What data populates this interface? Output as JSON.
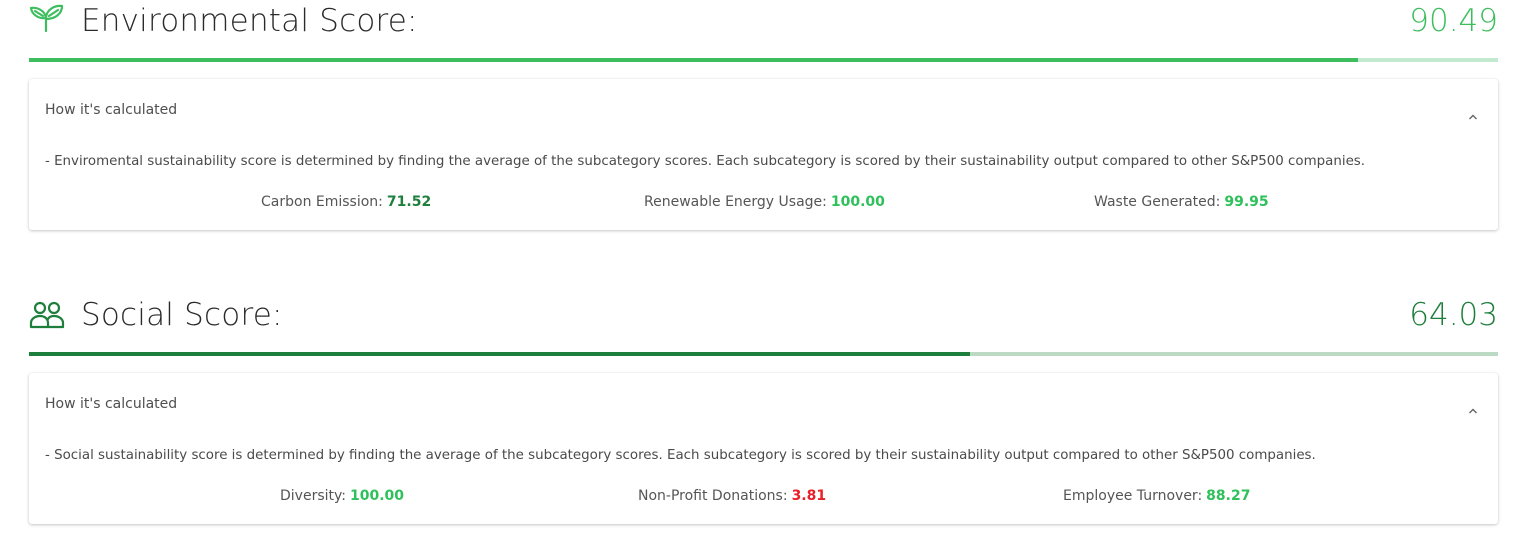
{
  "colors": {
    "good": "#2ec05a",
    "bad": "#e8202a",
    "environmental_accent": "#3dbd5e",
    "environmental_track": "#c2ead0",
    "social_accent": "#1e7f3c",
    "social_track": "#bcd9c4"
  },
  "environmental": {
    "icon": "sprout-icon",
    "title": "Environmental Score:",
    "score": "90.49",
    "progress_percent": 90.49,
    "summary": "How it's calculated",
    "description": "- Enviromental sustainability score is determined by finding the average of the subcategory scores. Each subcategory is scored by their sustainability output compared to other S&P500 companies.",
    "metrics": [
      {
        "label": "Carbon Emission:",
        "value": "71.52",
        "status": "dark"
      },
      {
        "label": "Renewable Energy Usage:",
        "value": "100.00",
        "status": "good"
      },
      {
        "label": "Waste Generated:",
        "value": "99.95",
        "status": "good"
      }
    ]
  },
  "social": {
    "icon": "people-icon",
    "title": "Social Score:",
    "score": "64.03",
    "progress_percent": 64.03,
    "summary": "How it's calculated",
    "description": "- Social sustainability score is determined by finding the average of the subcategory scores. Each subcategory is scored by their sustainability output compared to other S&P500 companies.",
    "metrics": [
      {
        "label": "Diversity:",
        "value": "100.00",
        "status": "good"
      },
      {
        "label": "Non-Profit Donations:",
        "value": "3.81",
        "status": "bad"
      },
      {
        "label": "Employee Turnover:",
        "value": "88.27",
        "status": "good"
      }
    ]
  }
}
